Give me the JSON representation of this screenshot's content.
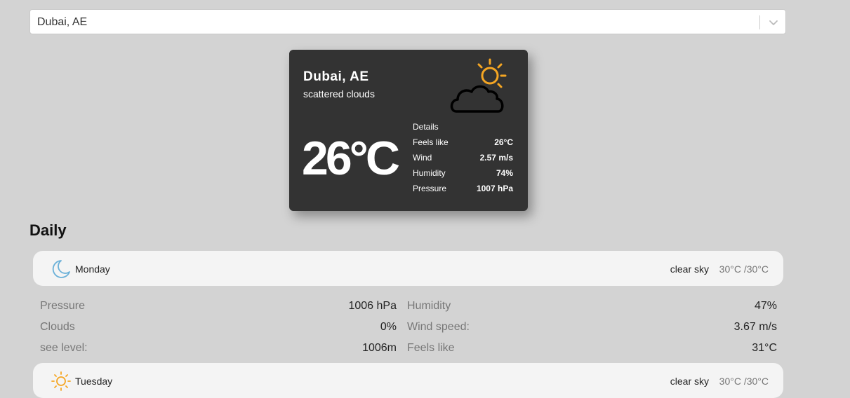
{
  "search": {
    "value": "Dubai, AE"
  },
  "current": {
    "city": "Dubai, AE",
    "description": "scattered clouds",
    "temperature": "26°C",
    "icon": "partly-cloudy-icon",
    "details_title": "Details",
    "details": [
      {
        "label": "Feels like",
        "value": "26°C"
      },
      {
        "label": "Wind",
        "value": "2.57 m/s"
      },
      {
        "label": "Humidity",
        "value": "74%"
      },
      {
        "label": "Pressure",
        "value": "1007 hPa"
      }
    ]
  },
  "daily": {
    "title": "Daily",
    "days": [
      {
        "name": "Monday",
        "icon": "moon-icon",
        "description": "clear sky",
        "range": "30°C /30°C",
        "details": [
          [
            {
              "label": "Pressure",
              "value": "1006 hPa"
            },
            {
              "label": "Humidity",
              "value": "47%"
            }
          ],
          [
            {
              "label": "Clouds",
              "value": "0%"
            },
            {
              "label": "Wind speed:",
              "value": "3.67 m/s"
            }
          ],
          [
            {
              "label": "see level:",
              "value": "1006m"
            },
            {
              "label": "Feels like",
              "value": "31°C"
            }
          ]
        ]
      },
      {
        "name": "Tuesday",
        "icon": "sun-icon",
        "description": "clear sky",
        "range": "30°C /30°C"
      }
    ]
  },
  "colors": {
    "sun": "#f5a623",
    "moon": "#6ab0d8",
    "card": "#333333",
    "background": "#d3d3d3"
  }
}
